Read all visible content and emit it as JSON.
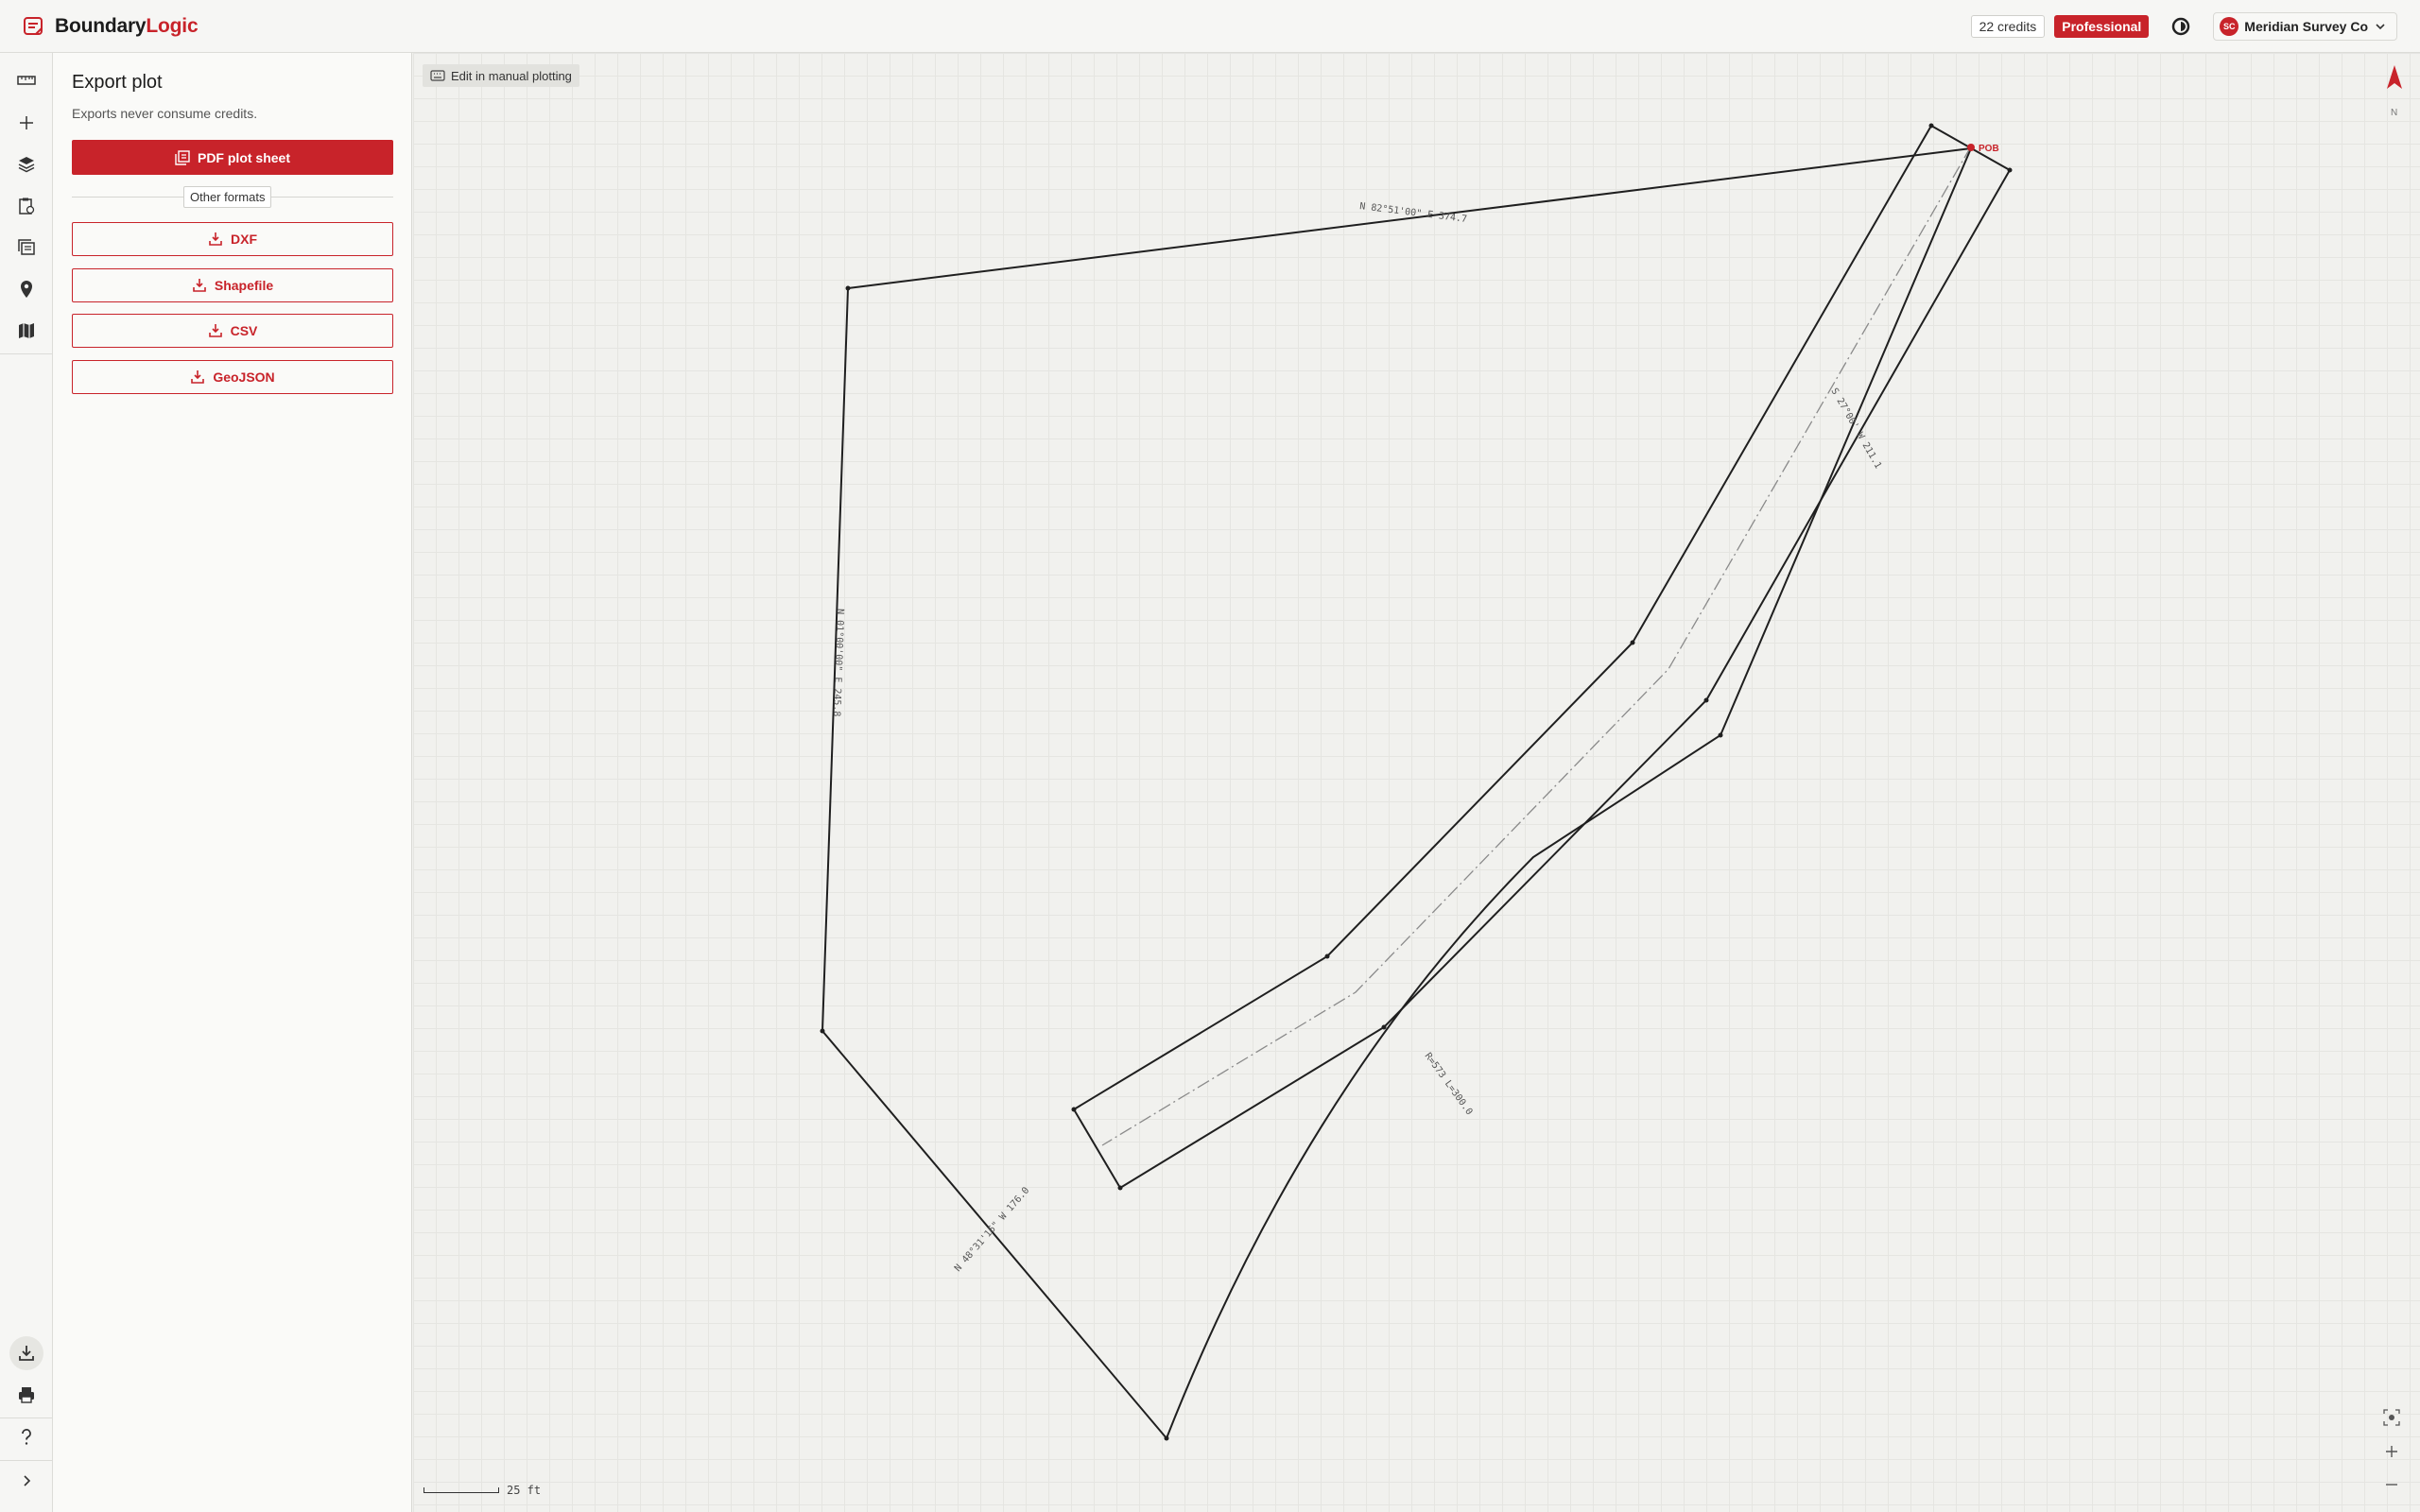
{
  "brand": {
    "name_part1": "Boundary",
    "name_part2": "Logic"
  },
  "header": {
    "credits": "22 credits",
    "plan": "Professional",
    "account_initials": "SC",
    "account_name": "Meridian Survey Co"
  },
  "rail": {
    "icons": [
      "ruler-icon",
      "plus-icon",
      "layers-icon",
      "clipboard-icon",
      "stack-icon",
      "pin-icon",
      "map-icon",
      "download-icon",
      "print-icon",
      "help-icon",
      "chevron-right-icon"
    ]
  },
  "panel": {
    "title": "Export plot",
    "subtitle": "Exports never consume credits.",
    "primary_label": "PDF plot sheet",
    "divider_label": "Other formats",
    "formats": [
      "DXF",
      "Shapefile",
      "CSV",
      "GeoJSON"
    ]
  },
  "map": {
    "chip_label": "Edit in manual plotting",
    "north_label": "N",
    "pob_label": "POB",
    "scale_label": "25 ft",
    "calls": {
      "north": "N 82°51'00\" E 374.7",
      "west": "N 01°00'00\" E 245.8",
      "southwest": "N 48°31'16\" W 176.0",
      "curve": "R=573 L=300.0",
      "east": "S 27°00' W 211.1"
    }
  },
  "colors": {
    "accent": "#c8232a",
    "line": "#1f1f1f"
  }
}
